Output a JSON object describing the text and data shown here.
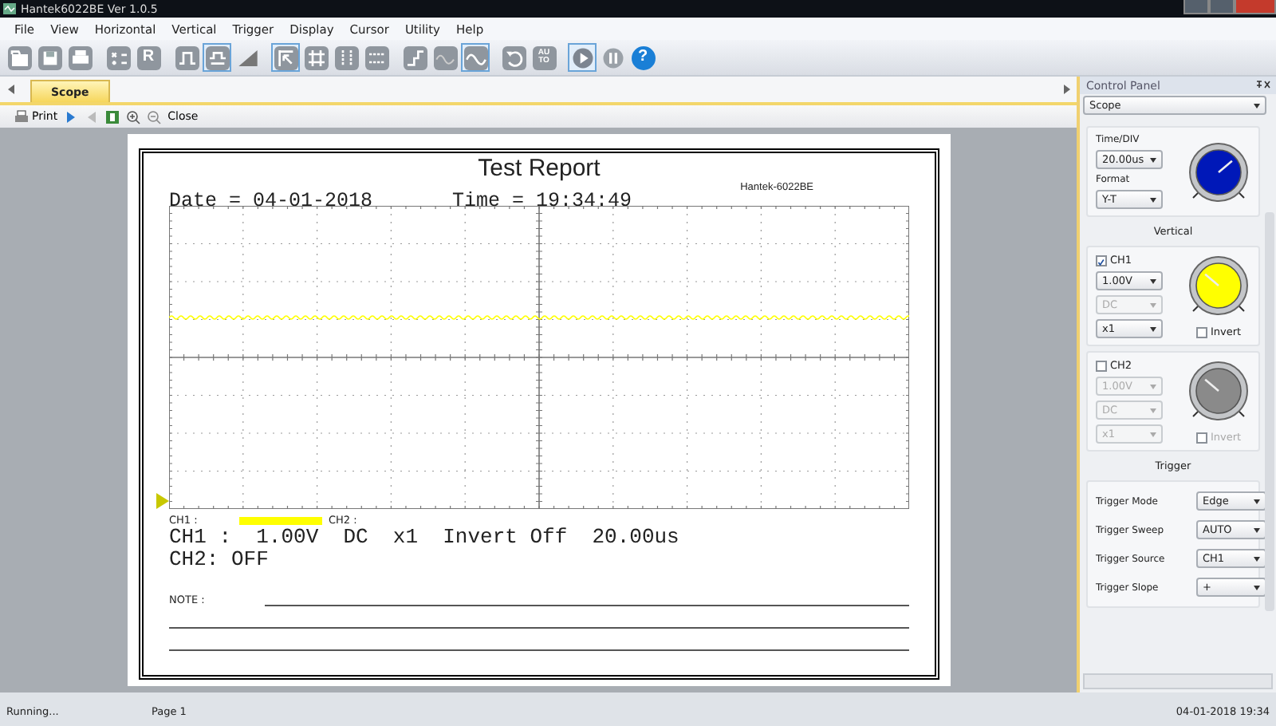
{
  "window": {
    "title": "Hantek6022BE Ver 1.0.5"
  },
  "menu": [
    "File",
    "View",
    "Horizontal",
    "Vertical",
    "Trigger",
    "Display",
    "Cursor",
    "Utility",
    "Help"
  ],
  "toolbar": [
    [
      {
        "kind": "open",
        "selected": false
      },
      {
        "kind": "save",
        "selected": false
      },
      {
        "kind": "print",
        "selected": false
      }
    ],
    [
      {
        "kind": "math",
        "selected": false
      },
      {
        "kind": "reference",
        "label": "R",
        "selected": false
      }
    ],
    [
      {
        "kind": "pulse",
        "selected": false
      },
      {
        "kind": "pulse-alt",
        "selected": true
      },
      {
        "kind": "ramp",
        "selected": false
      }
    ],
    [
      {
        "kind": "cursor",
        "selected": true
      },
      {
        "kind": "grid",
        "selected": false
      },
      {
        "kind": "vertical-lines",
        "selected": false
      },
      {
        "kind": "horizontal-lines",
        "selected": false
      }
    ],
    [
      {
        "kind": "step",
        "selected": false
      },
      {
        "kind": "wave-dim",
        "selected": false
      },
      {
        "kind": "wave",
        "selected": true
      }
    ],
    [
      {
        "kind": "undo",
        "selected": false
      },
      {
        "kind": "auto",
        "label": "AU TO",
        "selected": false
      }
    ],
    [
      {
        "kind": "play",
        "selected": true
      },
      {
        "kind": "pause",
        "selected": false
      },
      {
        "kind": "help",
        "label": "?",
        "selected": false
      }
    ]
  ],
  "tabs": [
    {
      "label": "Scope",
      "selected": true
    }
  ],
  "print_toolbar": {
    "print": "Print",
    "close": "Close"
  },
  "report": {
    "title": "Test Report",
    "device": "Hantek-6022BE",
    "date": "Date = 04-01-2018",
    "time": "Time = 19:34:49",
    "legend": [
      {
        "label": "CH1 :",
        "color": "#ffff00"
      },
      {
        "label": "CH2 :"
      }
    ],
    "lines": [
      "CH1 :  1.00V  DC  x1  Invert Off  20.00us",
      "CH2: OFF"
    ],
    "note": "NOTE :"
  },
  "control_panel": {
    "title": "Control Panel",
    "view": "Scope",
    "timebase": {
      "label": "Time/DIV",
      "value": "20.00us",
      "format_label": "Format",
      "format": "Y-T",
      "color": "#0018b8"
    },
    "vertical_title": "Vertical",
    "channels": [
      {
        "name": "CH1",
        "checked": true,
        "volts": "1.00V",
        "coupling": "DC",
        "probe": "x1",
        "invert": "Invert",
        "invert_checked": false,
        "color": "#ffff00"
      },
      {
        "name": "CH2",
        "checked": false,
        "volts": "1.00V",
        "coupling": "DC",
        "probe": "x1",
        "invert": "Invert",
        "invert_checked": false,
        "color": "#8a8a8a"
      }
    ],
    "trigger_title": "Trigger",
    "trigger": [
      {
        "label": "Trigger Mode",
        "value": "Edge"
      },
      {
        "label": "Trigger Sweep",
        "value": "AUTO"
      },
      {
        "label": "Trigger Source",
        "value": "CH1"
      },
      {
        "label": "Trigger Slope",
        "value": "+"
      }
    ]
  },
  "status_bar": {
    "state": "Running...",
    "page": "Page 1",
    "datetime": "04-01-2018 19:34"
  }
}
